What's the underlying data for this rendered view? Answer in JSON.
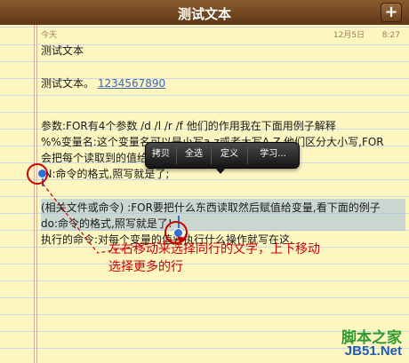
{
  "header": {
    "title": "测试文本",
    "add_label": "+"
  },
  "note": {
    "date_label": "今天",
    "date_value": "12月5日",
    "time_value": "8:27",
    "lines": [
      "测试文本",
      "测试文本。",
      "参数:FOR有4个参数 /d    /l    /r    /f    他们的作用我在下面用例子解释",
      "%%变量名:这个变量名可以是小写a-z或者大写A-Z,他们区分大小写,FOR",
      "会把每个读取到的值给",
      "IN:命令的格式,照写就是了;",
      "(相关文件或命令) :FOR要把什么东西读取然后赋值给变量,看下面的例子",
      "do:命令的格式,照写就是了!",
      "执行的命令:对每个变量的值要执行什么操作就写在这."
    ],
    "link_text": "1234567890"
  },
  "edit_menu": {
    "items": [
      "拷贝",
      "全选",
      "定义",
      "学习..."
    ]
  },
  "annotation": {
    "line1": "左右移动来选择同行的文字，上下移动",
    "line2": "选择更多的行"
  },
  "watermark": {
    "line1": "脚本之家",
    "line2": "JB51.Net"
  },
  "colors": {
    "annotation": "#cc0000",
    "selection_handle": "#2f6fd6",
    "watermark_green": "#2f9a2f",
    "watermark_blue": "#1e5bb5"
  }
}
